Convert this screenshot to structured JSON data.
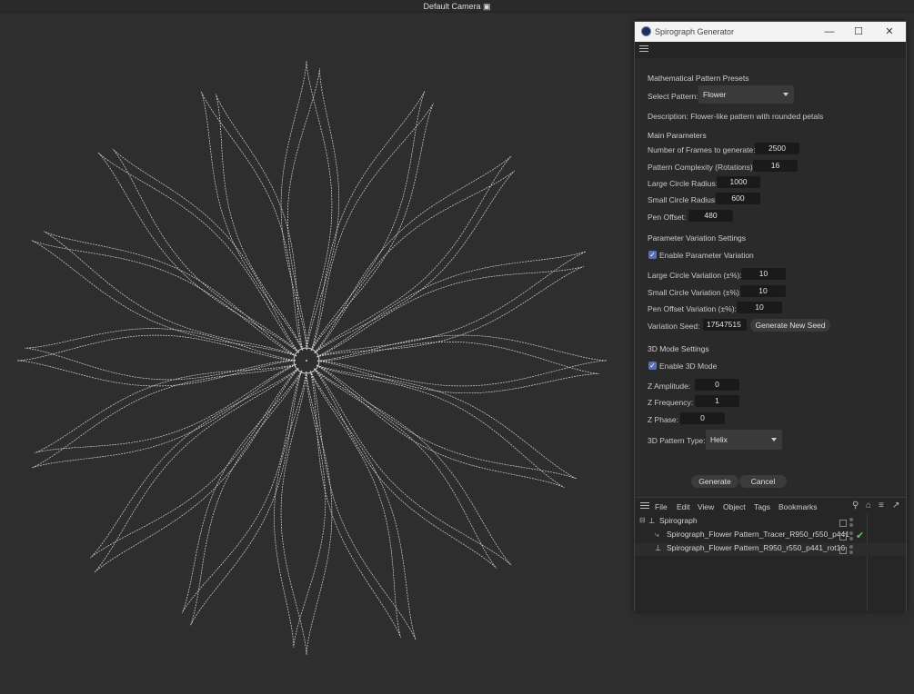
{
  "viewport": {
    "camera_label": "Default Camera",
    "camera_icon": "camera-icon"
  },
  "dialog": {
    "title": "Spirograph Generator",
    "window_buttons": {
      "minimize": "—",
      "maximize": "☐",
      "close": "✕"
    },
    "presets_heading": "Mathematical Pattern Presets",
    "select_pattern_label": "Select Pattern:",
    "select_pattern_value": "Flower",
    "description": "Description: Flower-like pattern with rounded petals",
    "main_heading": "Main Parameters",
    "frames_label": "Number of Frames to generate:",
    "frames_value": "2500",
    "complexity_label": "Pattern Complexity (Rotations):",
    "complexity_value": "16",
    "large_radius_label": "Large Circle Radius:",
    "large_radius_value": "1000",
    "small_radius_label": "Small Circle Radius:",
    "small_radius_value": "600",
    "pen_offset_label": "Pen Offset:",
    "pen_offset_value": "480",
    "variation_heading": "Parameter Variation Settings",
    "enable_variation_label": "Enable Parameter Variation",
    "large_var_label": "Large Circle Variation (±%):",
    "large_var_value": "10",
    "small_var_label": "Small Circle Variation (±%):",
    "small_var_value": "10",
    "pen_var_label": "Pen Offset Variation (±%):",
    "pen_var_value": "10",
    "seed_label": "Variation Seed:",
    "seed_value": "17547515",
    "generate_seed_button": "Generate New Seed",
    "mode3d_heading": "3D Mode Settings",
    "enable_3d_label": "Enable 3D Mode",
    "z_amp_label": "Z Amplitude:",
    "z_amp_value": "0",
    "z_freq_label": "Z Frequency:",
    "z_freq_value": "1",
    "z_phase_label": "Z Phase:",
    "z_phase_value": "0",
    "pattern3d_label": "3D Pattern Type:",
    "pattern3d_value": "Helix",
    "generate_button": "Generate",
    "cancel_button": "Cancel"
  },
  "object_manager": {
    "menu": [
      "File",
      "Edit",
      "View",
      "Object",
      "Tags",
      "Bookmarks"
    ],
    "objects": [
      {
        "name": "Spirograph"
      },
      {
        "name": "Spirograph_Flower Pattern_Tracer_R950_r550_p441"
      },
      {
        "name": "Spirograph_Flower Pattern_R950_r550_p441_rot16"
      }
    ]
  },
  "colors": {
    "background": "#2e2e2e",
    "curve": "#d4d4d4",
    "accent": "#5a6fb8",
    "check": "#57c46a"
  }
}
